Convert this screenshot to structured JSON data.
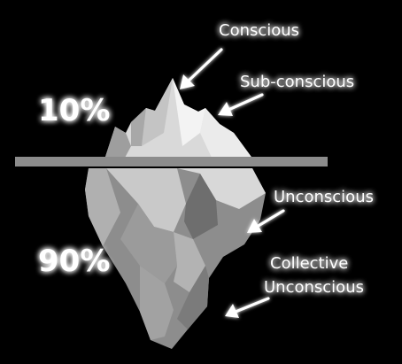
{
  "diagram": {
    "percent_above": "10%",
    "percent_below": "90%",
    "labels": {
      "conscious": "Conscious",
      "subconscious": "Sub-conscious",
      "unconscious": "Unconscious",
      "collective_line1": "Collective",
      "collective_line2": "Unconscious"
    }
  },
  "colors": {
    "background": "#000000",
    "text": "#ffffff",
    "waterline": "#8c8c8c",
    "ice_light": "#e6e6e6",
    "ice_mid": "#b8b8b8",
    "ice_dark": "#6c6c6c"
  }
}
